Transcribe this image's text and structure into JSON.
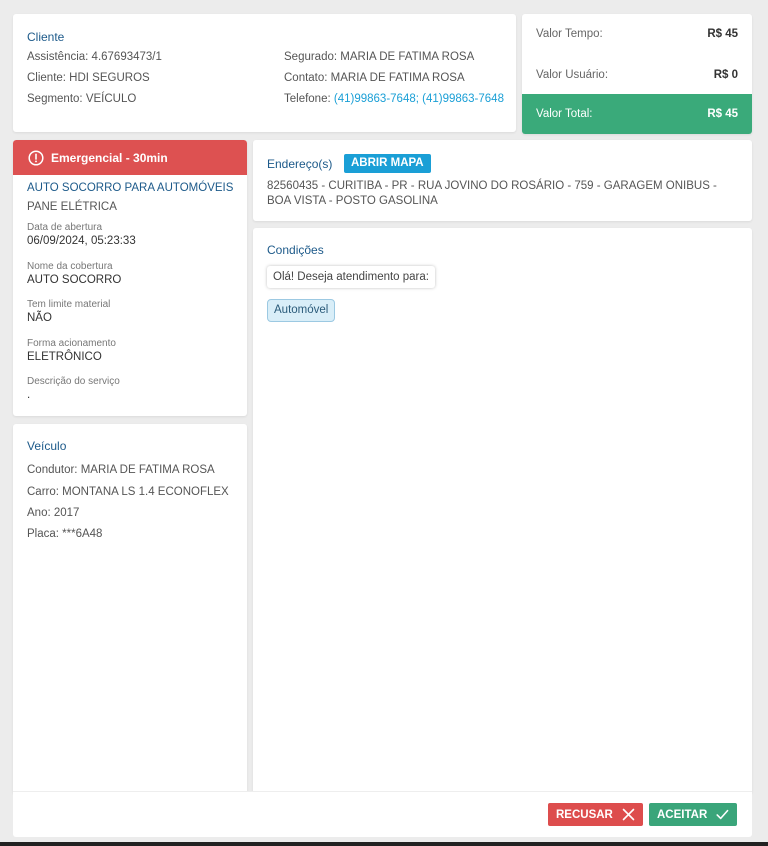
{
  "client": {
    "title": "Cliente",
    "assistencia": "Assistência: 4.67693473/1",
    "cliente": "Cliente: HDI SEGUROS",
    "segmento": "Segmento: VEÍCULO",
    "segurado": "Segurado: MARIA DE FATIMA ROSA",
    "contato": "Contato: MARIA DE FATIMA ROSA",
    "telefone_label": "Telefone:",
    "telefone_value": "(41)99863-7648; (41)99863-7648"
  },
  "values": {
    "tempo_label": "Valor Tempo:",
    "tempo_value": "R$ 45",
    "usuario_label": "Valor Usuário:",
    "usuario_value": "R$ 0",
    "total_label": "Valor Total:",
    "total_value": "R$ 45"
  },
  "service": {
    "banner": "Emergencial - 30min",
    "name": "AUTO SOCORRO PARA AUTOMÓVEIS",
    "type": "PANE ELÉTRICA",
    "opened_label": "Data de abertura",
    "opened_value": "06/09/2024, 05:23:33",
    "coverage_label": "Nome da cobertura",
    "coverage_value": "AUTO SOCORRO",
    "limit_label": "Tem limite material",
    "limit_value": "NÃO",
    "trigger_label": "Forma acionamento",
    "trigger_value": "ELETRÔNICO",
    "desc_label": "Descrição do serviço",
    "desc_value": "."
  },
  "vehicle": {
    "title": "Veículo",
    "condutor": "Condutor: MARIA DE FATIMA ROSA",
    "carro": "Carro: MONTANA LS 1.4 ECONOFLEX",
    "ano": "Ano: 2017",
    "placa": "Placa: ***6A48"
  },
  "address": {
    "title": "Endereço(s)",
    "map_button": "ABRIR MAPA",
    "text": "82560435 - CURITIBA - PR - RUA JOVINO DO ROSÁRIO - 759 - GARAGEM ONIBUS - BOA VISTA - POSTO GASOLINA"
  },
  "conditions": {
    "title": "Condições",
    "question": "Olá! Deseja atendimento para:",
    "option": "Automóvel"
  },
  "actions": {
    "refuse": "RECUSAR",
    "accept": "ACEITAR"
  },
  "colors": {
    "emergency": "#dd5151",
    "total": "#3aaa7a",
    "link": "#1a9fd6",
    "refuse": "#dd4d4d",
    "accept": "#3aa57a"
  },
  "icons": {
    "emergency": "alert-circle-icon",
    "refuse": "close-icon",
    "accept": "check-icon"
  }
}
